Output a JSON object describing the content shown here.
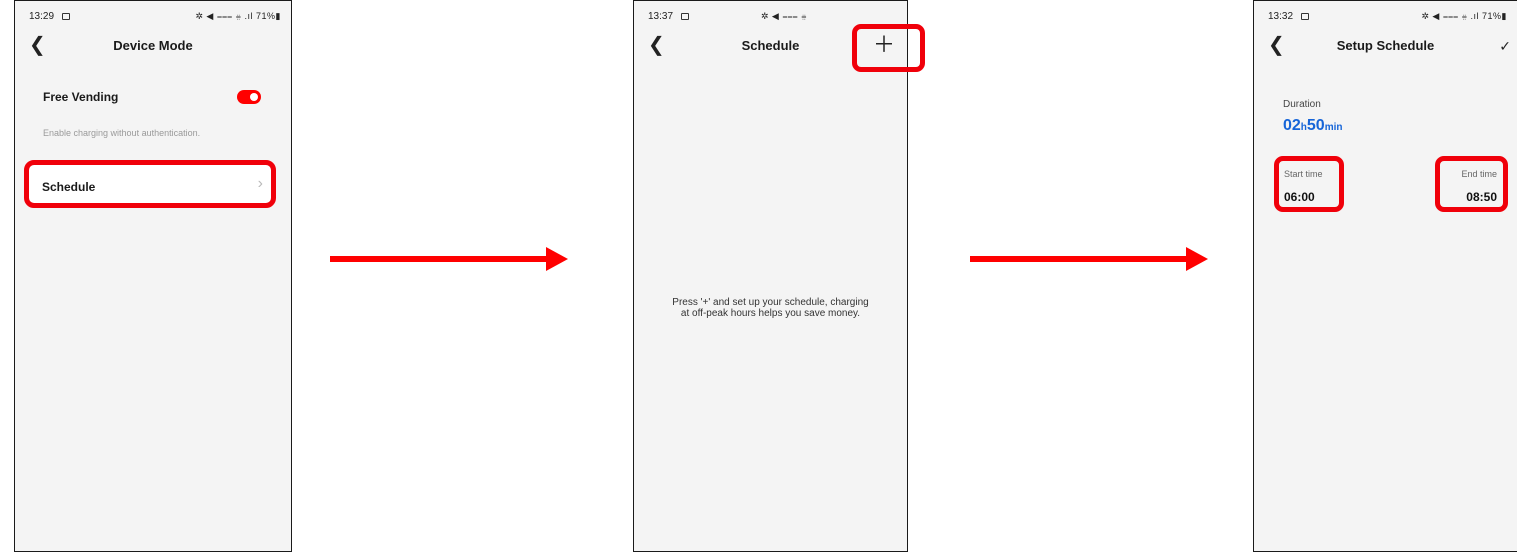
{
  "screen1": {
    "status": {
      "time": "13:29",
      "right": "✲ ◀ ⩶ ⩷ .ıl 71%▮"
    },
    "title": "Device Mode",
    "free_vending": {
      "label": "Free Vending",
      "enabled": true
    },
    "description": "Enable charging without authentication.",
    "schedule_label": "Schedule"
  },
  "screen2": {
    "status": {
      "time": "13:37",
      "right": "✲ ◀ ⩶ ⩷"
    },
    "title": "Schedule",
    "empty_line1": "Press '+' and set up your schedule, charging",
    "empty_line2": "at off-peak hours helps you save money."
  },
  "screen3": {
    "status": {
      "time": "13:32",
      "right": "✲ ◀ ⩶ ⩷ .ıl 71%▮"
    },
    "title": "Setup Schedule",
    "duration_label": "Duration",
    "duration_hours": "02",
    "duration_h_unit": "h",
    "duration_minutes": "50",
    "duration_min_unit": "min",
    "start_label": "Start time",
    "start_value": "06:00",
    "end_label": "End time",
    "end_value": "08:50"
  },
  "colors": {
    "accent": "#ff0000",
    "duration_blue": "#1665d8",
    "background": "#f4f4f4"
  },
  "icons": [
    "back-icon",
    "chevron-right-icon",
    "plus-icon",
    "check-icon",
    "toggle-switch",
    "arrow-right-icon"
  ]
}
